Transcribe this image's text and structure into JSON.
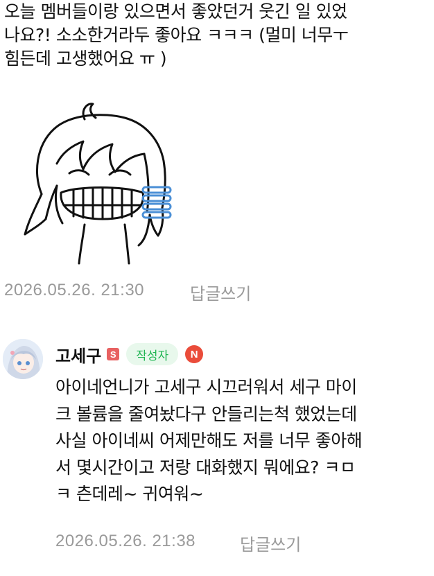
{
  "comment": {
    "text_lines": [
      "오늘 멤버들이랑 있으면서 좋았던거 웃긴 일 있었",
      "나요?! 소소한거라두 좋아요 ㅋㅋㅋ (멀미 너무ㅜ",
      "힘든데 고생했어요 ㅠ )"
    ],
    "timestamp": "2026.05.26. 21:30",
    "reply_label": "답글쓰기"
  },
  "reply": {
    "nickname": "고세구",
    "level_badge": "S",
    "author_badge": "작성자",
    "new_badge": "N",
    "text_lines": [
      "아이네언니가 고세구 시끄러워서 세구 마이",
      "크 볼륨을 줄여놨다구 안들리는척 했었는데",
      "사실 아이네씨 어제만해도 저를 너무 좋아해",
      "서 몇시간이고 저랑 대화했지 뭐에요? ㅋㅁ",
      "ㅋ 츤데레~ 귀여워~"
    ],
    "timestamp": "2026.05.26. 21:38",
    "reply_label": "답글쓰기"
  },
  "icons": {
    "sticker": "grinning-girl-sticker",
    "avatar": "anime-avatar"
  }
}
